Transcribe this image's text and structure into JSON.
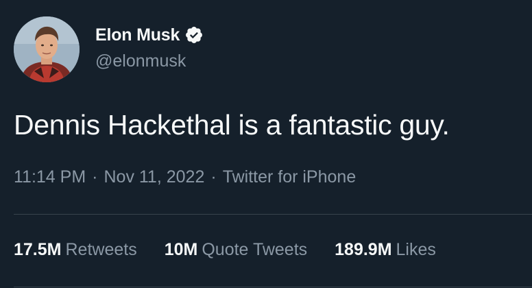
{
  "user": {
    "display_name": "Elon Musk",
    "handle": "@elonmusk",
    "verified": true,
    "avatar_icon": "profile-photo",
    "verified_icon": "verified-badge-icon"
  },
  "tweet": {
    "text": "Dennis Hackethal is a fantastic guy.",
    "time": "11:14 PM",
    "date": "Nov 11, 2022",
    "source": "Twitter for iPhone",
    "separator": "·"
  },
  "stats": {
    "retweets_count": "17.5M",
    "retweets_label": "Retweets",
    "quote_tweets_count": "10M",
    "quote_tweets_label": "Quote Tweets",
    "likes_count": "189.9M",
    "likes_label": "Likes"
  },
  "colors": {
    "background": "#15202b",
    "primary_text": "#f7f9f9",
    "secondary_text": "#8b98a5",
    "divider": "#38444d"
  }
}
